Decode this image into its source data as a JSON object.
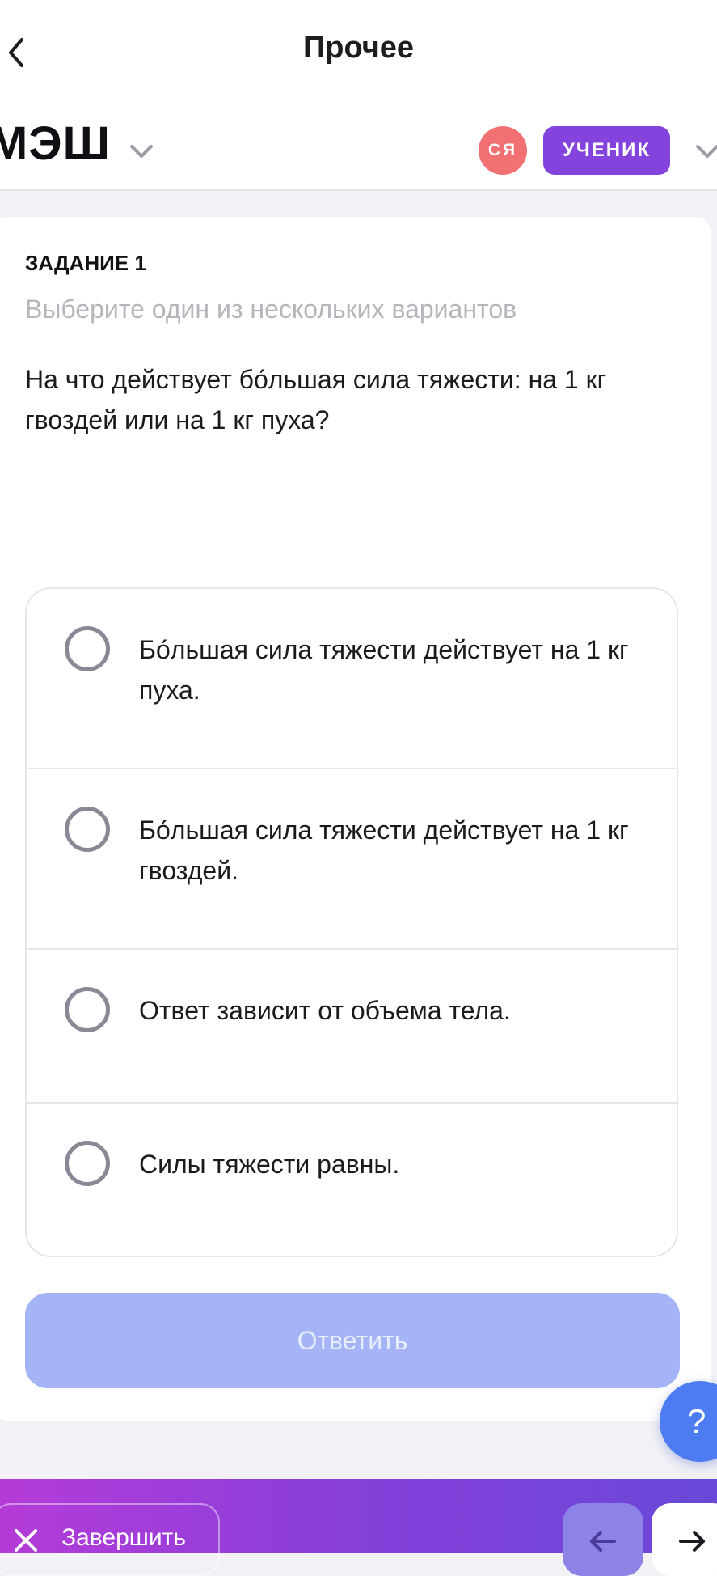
{
  "nav": {
    "title": "Прочее"
  },
  "brand": {
    "logo": "МЭШ",
    "avatar_initials": "СЯ",
    "role": "УЧЕНИК"
  },
  "task": {
    "number_label": "ЗАДАНИЕ 1",
    "instruction": "Выберите один из нескольких вариантов",
    "question": "На что действует бо́льшая сила тяжести: на 1 кг гвоздей или на 1 кг пуха?",
    "options": [
      {
        "label": "Бо́льшая сила тяжести действует на 1 кг пуха.",
        "selected": false
      },
      {
        "label": "Бо́льшая сила тяжести действует на 1 кг гвоздей.",
        "selected": false
      },
      {
        "label": "Ответ зависит от объема тела.",
        "selected": false
      },
      {
        "label": "Силы тяжести равны.",
        "selected": false
      }
    ],
    "submit_label": "Ответить",
    "submit_enabled": false
  },
  "help": {
    "symbol": "?"
  },
  "bottom_bar": {
    "finish_label": "Завершить"
  },
  "colors": {
    "accent_purple": "#8543dd",
    "avatar_red": "#f17173",
    "submit_disabled": "#a4b4f6",
    "help_blue": "#4d7cf2"
  },
  "icons": [
    "back-chevron-icon",
    "chevron-down-icon",
    "close-icon",
    "arrow-left-icon",
    "arrow-right-icon",
    "question-icon"
  ]
}
